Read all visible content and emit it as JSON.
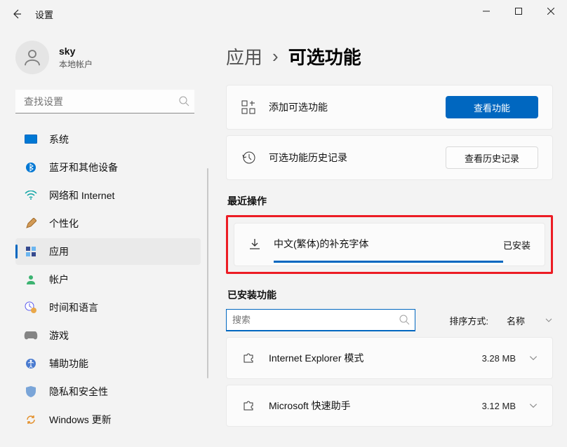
{
  "window": {
    "title": "设置"
  },
  "user": {
    "name": "sky",
    "sub": "本地帐户"
  },
  "search": {
    "placeholder": "查找设置"
  },
  "nav": [
    {
      "label": "系统"
    },
    {
      "label": "蓝牙和其他设备"
    },
    {
      "label": "网络和 Internet"
    },
    {
      "label": "个性化"
    },
    {
      "label": "应用"
    },
    {
      "label": "帐户"
    },
    {
      "label": "时间和语言"
    },
    {
      "label": "游戏"
    },
    {
      "label": "辅助功能"
    },
    {
      "label": "隐私和安全性"
    },
    {
      "label": "Windows 更新"
    }
  ],
  "breadcrumb": {
    "parent": "应用",
    "current": "可选功能"
  },
  "add": {
    "label": "添加可选功能",
    "btn": "查看功能"
  },
  "history": {
    "label": "可选功能历史记录",
    "btn": "查看历史记录"
  },
  "sections": {
    "recent": "最近操作",
    "installed": "已安装功能"
  },
  "recent": {
    "name": "中文(繁体)的补充字体",
    "status": "已安装"
  },
  "searchInstalled": {
    "placeholder": "搜索"
  },
  "sort": {
    "label": "排序方式:",
    "value": "名称"
  },
  "features": [
    {
      "name": "Internet Explorer 模式",
      "size": "3.28 MB"
    },
    {
      "name": "Microsoft 快速助手",
      "size": "3.12 MB"
    }
  ]
}
